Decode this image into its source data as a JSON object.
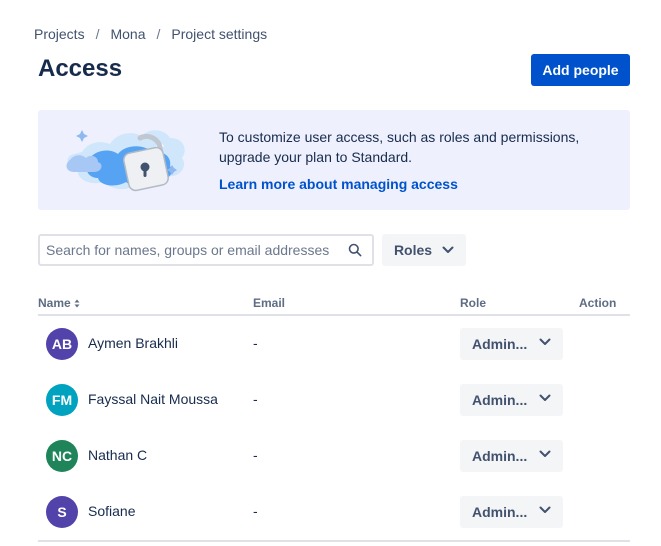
{
  "breadcrumb": [
    "Projects",
    "Mona",
    "Project settings"
  ],
  "breadcrumb_separator": "/",
  "page": {
    "title": "Access",
    "add_people_label": "Add people"
  },
  "banner": {
    "text": "To customize user access, such as roles and permissions, upgrade your plan to Standard.",
    "link": "Learn more about managing access"
  },
  "search": {
    "placeholder": "Search for names, groups or email addresses",
    "value": "",
    "icon": "search-icon"
  },
  "roles_filter": {
    "label": "Roles",
    "icon": "chevron-down-icon"
  },
  "table": {
    "headers": {
      "name": "Name",
      "email": "Email",
      "role": "Role",
      "action": "Action"
    },
    "rows": [
      {
        "initials": "AB",
        "avatar_color": "#5243aa",
        "name": "Aymen Brakhli",
        "email": "-",
        "role": "Admin..."
      },
      {
        "initials": "FM",
        "avatar_color": "#00a3bf",
        "name": "Fayssal Nait Moussa",
        "email": "-",
        "role": "Admin..."
      },
      {
        "initials": "NC",
        "avatar_color": "#1f845a",
        "name": "Nathan C",
        "email": "-",
        "role": "Admin..."
      },
      {
        "initials": "S",
        "avatar_color": "#5243aa",
        "name": "Sofiane",
        "email": "-",
        "role": "Admin..."
      }
    ]
  },
  "colors": {
    "primary": "#0052cc",
    "banner_bg": "#eef1fd",
    "text": "#172b4d"
  }
}
